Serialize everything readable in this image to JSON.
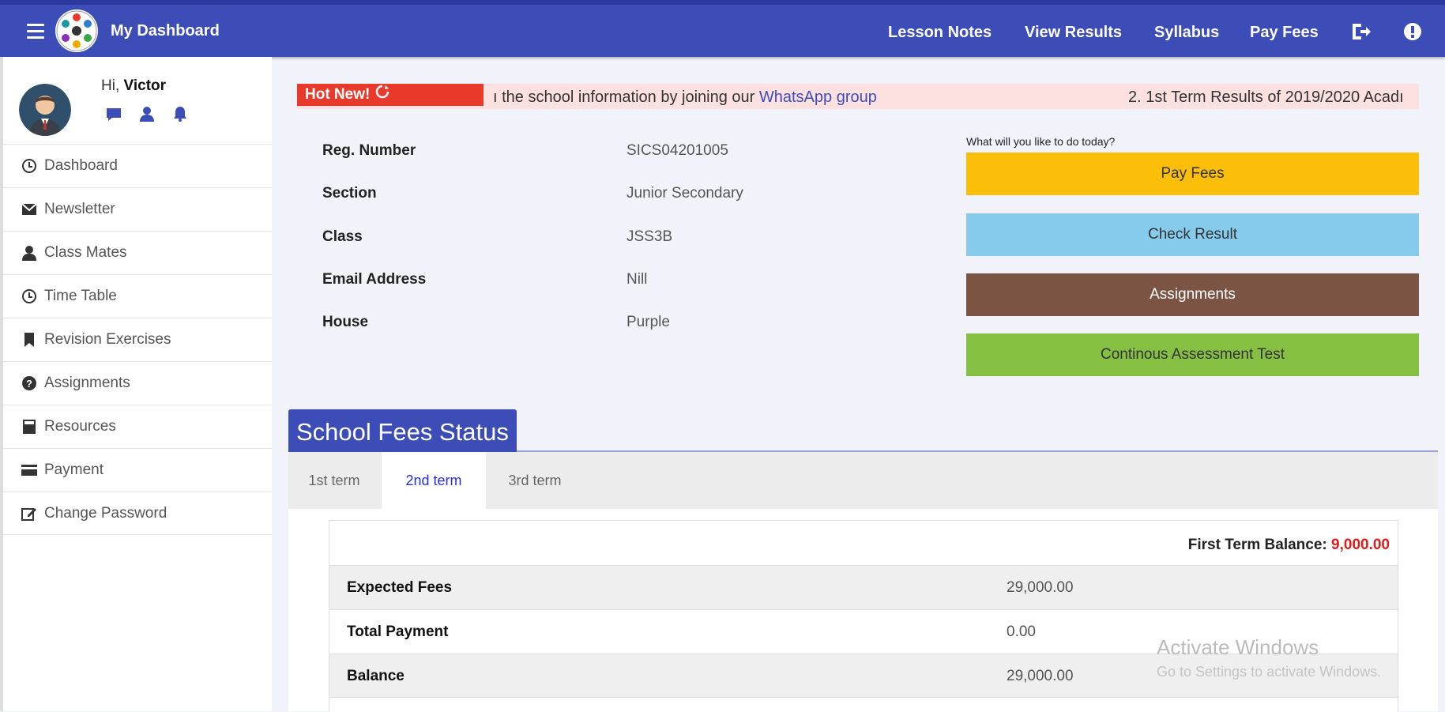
{
  "header": {
    "brand": "My Dashboard",
    "nav": [
      "Lesson Notes",
      "View Results",
      "Syllabus",
      "Pay Fees"
    ],
    "icons": [
      "menu-icon",
      "logout-icon",
      "help-icon"
    ]
  },
  "user": {
    "greeting": "Hi,",
    "name": "Victor",
    "icons": [
      "chat-icon",
      "user-icon",
      "bell-icon"
    ]
  },
  "sidebar": {
    "items": [
      {
        "label": "Dashboard",
        "icon": "dashboard-icon"
      },
      {
        "label": "Newsletter",
        "icon": "envelope-icon"
      },
      {
        "label": "Class Mates",
        "icon": "user-icon"
      },
      {
        "label": "Time Table",
        "icon": "clock-icon"
      },
      {
        "label": "Revision Exercises",
        "icon": "bookmark-icon"
      },
      {
        "label": "Assignments",
        "icon": "question-icon"
      },
      {
        "label": "Resources",
        "icon": "book-icon"
      },
      {
        "label": "Payment",
        "icon": "card-icon"
      },
      {
        "label": "Change Password",
        "icon": "edit-icon"
      }
    ]
  },
  "marquee": {
    "badge": "Hot New!",
    "text_pre": "ı the school information by joining our",
    "link": "WhatsApp group",
    "text_next": "2. 1st Term Results of 2019/2020 Acadı"
  },
  "profile": {
    "rows": [
      {
        "label": "Reg. Number",
        "value": "SICS04201005"
      },
      {
        "label": "Section",
        "value": "Junior Secondary"
      },
      {
        "label": "Class",
        "value": "JSS3B"
      },
      {
        "label": "Email Address",
        "value": "Nill"
      },
      {
        "label": "House",
        "value": "Purple"
      }
    ]
  },
  "actions": {
    "prompt": "What will you like to do today?",
    "buttons": [
      {
        "label": "Pay Fees",
        "color": "#fbbf0a"
      },
      {
        "label": "Check Result",
        "color": "#86cbeb"
      },
      {
        "label": "Assignments",
        "color": "#7b5444"
      },
      {
        "label": "Continous Assessment Test",
        "color": "#86c043"
      }
    ]
  },
  "fees": {
    "title": "School Fees Status",
    "tabs": [
      "1st term",
      "2nd term",
      "3rd term"
    ],
    "active_tab": "2nd term",
    "balance_label": "First Term Balance:",
    "balance_value": "9,000.00",
    "rows": [
      {
        "label": "Expected Fees",
        "value": "29,000.00"
      },
      {
        "label": "Total Payment",
        "value": "0.00"
      },
      {
        "label": "Balance",
        "value": "29,000.00"
      }
    ]
  },
  "watermark": {
    "title": "Activate Windows",
    "subtitle": "Go to Settings to activate Windows."
  },
  "colors": {
    "header_bg": "#3d4db7",
    "hot_badge": "#e8392a",
    "balance_red": "#e01b1b",
    "active_tab_text": "#2630d6"
  }
}
